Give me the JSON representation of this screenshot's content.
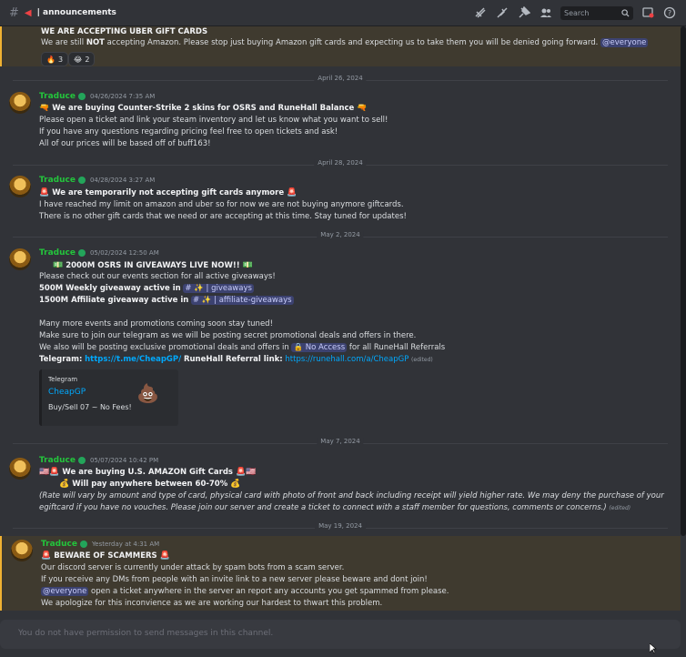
{
  "topbar": {
    "channel": "| announcements",
    "search_placeholder": "Search"
  },
  "messages": [
    {
      "lines": [
        "WE ARE ACCEPTING UBER GIFT CARDS",
        "We are still ",
        "NOT",
        " accepting Amazon. Please stop just buying Amazon gift cards and expecting us to take them you will be denied going forward. ",
        "@everyone"
      ],
      "reactions": [
        {
          "emoji": "🔥",
          "count": "3"
        },
        {
          "emoji": "😂",
          "count": "2"
        }
      ]
    }
  ],
  "separators": {
    "s1": "April 26, 2024",
    "s2": "April 28, 2024",
    "s3": "May 2, 2024",
    "s4": "May 7, 2024",
    "s5": "May 19, 2024"
  },
  "m2": {
    "user": "Traduce",
    "time": "04/26/2024 7:35 AM",
    "title": "We are buying Counter-Strike 2 skins for OSRS and RuneHall Balance",
    "l1": "Please open a ticket and link your steam inventory and let us know what you want to sell!",
    "l2": "If you have any questions regarding pricing feel free to open tickets and ask!",
    "l3": "All of our prices will be based off of buff163!"
  },
  "m3": {
    "user": "Traduce",
    "time": "04/28/2024 3:27 AM",
    "title": "We are temporarily not accepting gift cards anymore",
    "l1": "I have reached my limit on amazon and uber so for now we are not buying anymore giftcards.",
    "l2": "There is no other gift cards that we need or are accepting at this time. Stay tuned for updates!"
  },
  "m4": {
    "user": "Traduce",
    "time": "05/02/2024 12:50 AM",
    "title": "2000M OSRS IN GIVEAWAYS LIVE NOW!!",
    "l1": "Please check out our events section for all active giveaways!",
    "l2a": "500M Weekly giveaway active in",
    "l2b": "| giveaways",
    "l3a": "1500M Affiliate giveaway active in",
    "l3b": "| affiliate-giveaways",
    "l4": "Many more events and promotions coming soon stay tuned!",
    "l5": "Make sure to join our telegram as we will be posting secret promotional deals and offers in there.",
    "l6a": "We also will be posting exclusive promotional deals and offers in",
    "l6b": "No Access",
    "l6c": "for all RuneHall Referrals",
    "l7a": "Telegram:",
    "l7b": "https://t.me/CheapGP/",
    "l7c": "RuneHall Referral link:",
    "l7d": "https://runehall.com/a/CheapGP",
    "edited": "(edited)",
    "embed_provider": "Telegram",
    "embed_title": "CheapGP",
    "embed_desc": "Buy/Sell 07 ~ No Fees!"
  },
  "m5": {
    "user": "Traduce",
    "time": "05/07/2024 10:42 PM",
    "title": "We are buying U.S. AMAZON Gift Cards",
    "l1": "Will pay anywhere between 60-70%",
    "l2": "(Rate will vary by amount and type of card, physical card with photo of front and back including receipt will yield higher rate. We may deny the purchase of your",
    "l3": "egiftcard if you have no vouches. Please join our server and create a ticket to connect with a staff member for questions, comments or concerns.)",
    "edited": "(edited)"
  },
  "m6": {
    "user": "Traduce",
    "time": "Yesterday at 4:31 AM",
    "title": "BEWARE OF SCAMMERS",
    "l1": "Our discord server is currently under attack by spam bots from a scam server.",
    "l2": "If you receive any DMs from people with an invite link to a new server please beware and dont join!",
    "l3a": "@everyone",
    "l3b": " open a ticket anywhere in the server an report any accounts you get spammed from please.",
    "l4": "We apologize for this inconvience as we are working our hardest to thwart this problem."
  },
  "composer": {
    "placeholder": "You do not have permission to send messages in this channel."
  }
}
